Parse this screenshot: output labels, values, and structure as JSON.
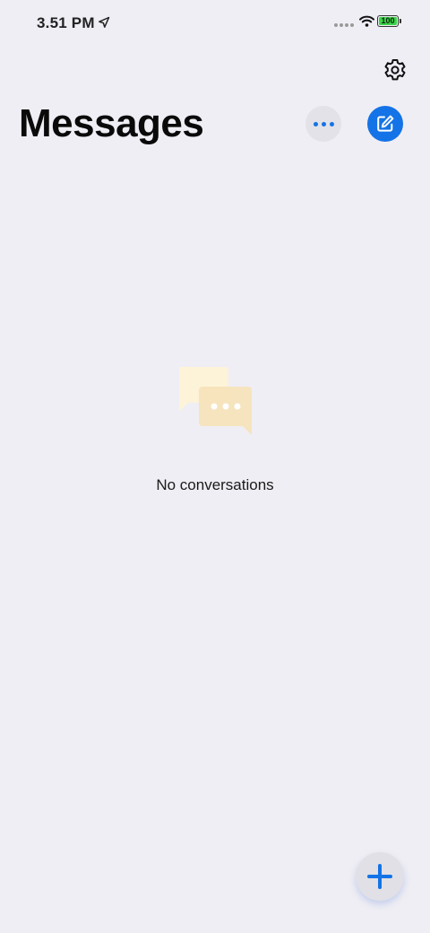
{
  "status_bar": {
    "time": "3.51 PM",
    "battery_level": "100",
    "location_icon": "location-arrow-icon",
    "wifi_icon": "wifi-icon",
    "signal_icon": "signal-dots-icon"
  },
  "header": {
    "title": "Messages",
    "settings_icon": "gear-icon",
    "more_icon": "ellipsis-icon",
    "compose_icon": "compose-icon"
  },
  "empty_state": {
    "icon": "chat-bubbles-icon",
    "message": "No conversations"
  },
  "fab": {
    "icon": "plus-icon"
  },
  "colors": {
    "background": "#efeef4",
    "accent": "#1473e6",
    "battery": "#3dd34a",
    "illustration_back": "#fdf3d9",
    "illustration_front": "#f6e2b8"
  }
}
